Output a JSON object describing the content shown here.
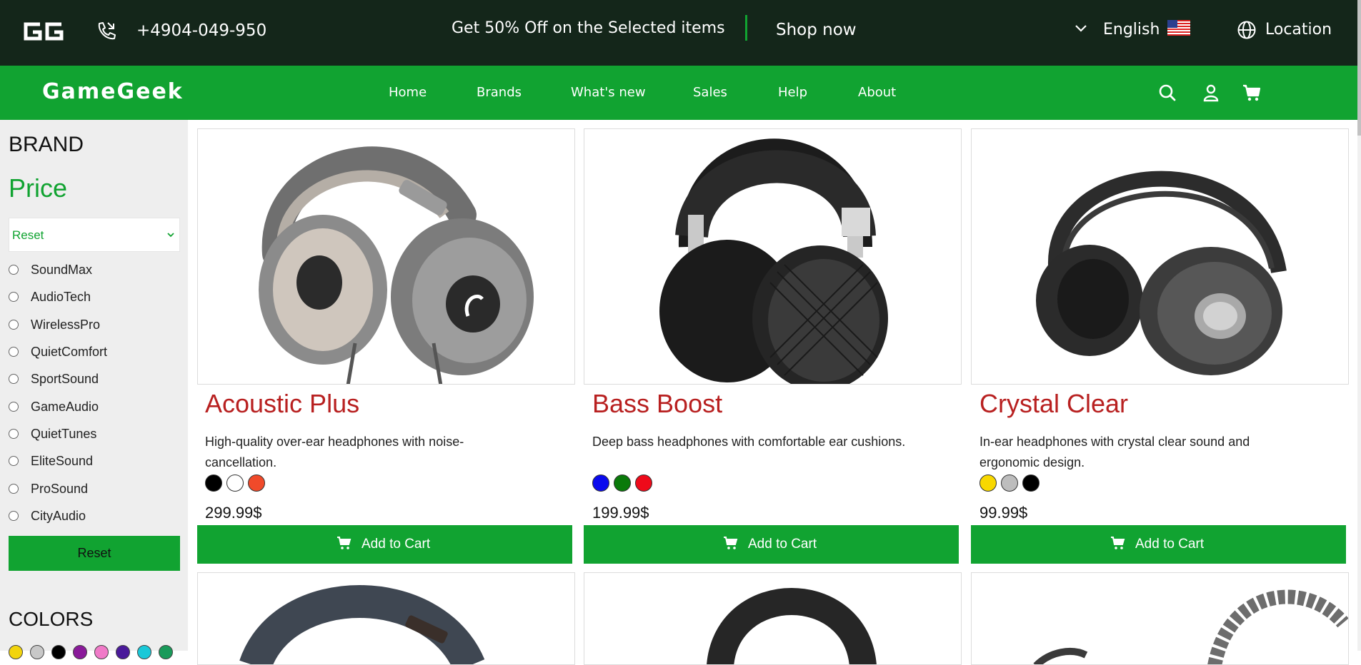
{
  "topbar": {
    "logo_icon": "gg-logo",
    "phone": "+4904-049-950",
    "promo": "Get 50% Off on the Selected items",
    "shop_now": "Shop now",
    "language": "English",
    "location": "Location",
    "accent_color": "#11a331",
    "bg_color": "#14261a"
  },
  "nav": {
    "logo": "GameGeek",
    "items": [
      "Home",
      "Brands",
      "What's new",
      "Sales",
      "Help",
      "About"
    ],
    "icons": [
      "search-icon",
      "user-icon",
      "cart-icon"
    ],
    "bg_color": "#11a331"
  },
  "sidebar": {
    "brand_heading": "BRAND",
    "price_heading": "Price",
    "price_select": "Reset",
    "brands": [
      "SoundMax",
      "AudioTech",
      "WirelessPro",
      "QuietComfort",
      "SportSound",
      "GameAudio",
      "QuietTunes",
      "EliteSound",
      "ProSound",
      "CityAudio"
    ],
    "reset_button": "Reset",
    "colors_heading": "COLORS",
    "color_swatches": [
      "#f2d40e",
      "#c8c8c8",
      "#000000",
      "#8a1a9a",
      "#f07ac8",
      "#4a1a9a",
      "#1ac8d8",
      "#1a9a5a"
    ]
  },
  "products": [
    {
      "title": "Acoustic Plus",
      "description": "High-quality over-ear headphones with noise-cancellation.",
      "colors": [
        "#000000",
        "#ffffff",
        "#f04a2a"
      ],
      "price": "299.99$",
      "cart_label": "Add to Cart"
    },
    {
      "title": "Bass Boost",
      "description": "Deep bass headphones with comfortable ear cushions.",
      "colors": [
        "#0a0aee",
        "#0a7a0a",
        "#ee0a1a"
      ],
      "price": "199.99$",
      "cart_label": "Add to Cart"
    },
    {
      "title": "Crystal Clear",
      "description": "In-ear headphones with crystal clear sound and ergonomic design.",
      "colors": [
        "#f8d800",
        "#bdbdbd",
        "#000000"
      ],
      "price": "99.99$",
      "cart_label": "Add to Cart"
    }
  ],
  "title_color": "#b82020"
}
